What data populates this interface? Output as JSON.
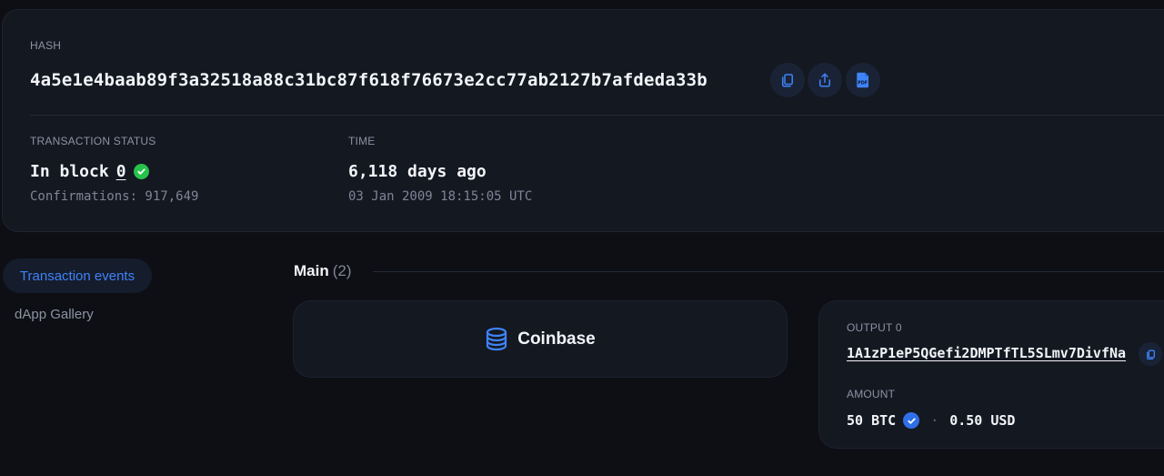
{
  "header": {
    "hash_label": "HASH",
    "hash_value": "4a5e1e4baab89f3a32518a88c31bc87f618f76673e2cc77ab2127b7afdeda33b",
    "actions": [
      {
        "icon": "copy-icon"
      },
      {
        "icon": "share-icon"
      },
      {
        "icon": "pdf-icon",
        "text": "PDF"
      }
    ]
  },
  "status": {
    "label": "TRANSACTION STATUS",
    "in_block_text": "In block",
    "block_number": "0",
    "confirmations": "Confirmations: 917,649",
    "status_color": "#27c24c"
  },
  "time": {
    "label": "TIME",
    "relative": "6,118 days ago",
    "absolute": "03 Jan 2009 18:15:05 UTC"
  },
  "sidebar": {
    "items": [
      {
        "label": "Transaction events",
        "active": true
      },
      {
        "label": "dApp Gallery",
        "active": false
      }
    ]
  },
  "main": {
    "title": "Main",
    "count": "(2)",
    "input": {
      "label": "Coinbase",
      "icon": "coin-stack-icon"
    },
    "output": {
      "label": "OUTPUT 0",
      "address": "1A1zP1eP5QGefi2DMPTfTL5SLmv7DivfNa",
      "amount_label": "AMOUNT",
      "amount": "50 BTC",
      "usd": "0.50 USD"
    }
  },
  "colors": {
    "accent": "#3f83f8",
    "background": "#0d0f14",
    "card": "#141821"
  }
}
